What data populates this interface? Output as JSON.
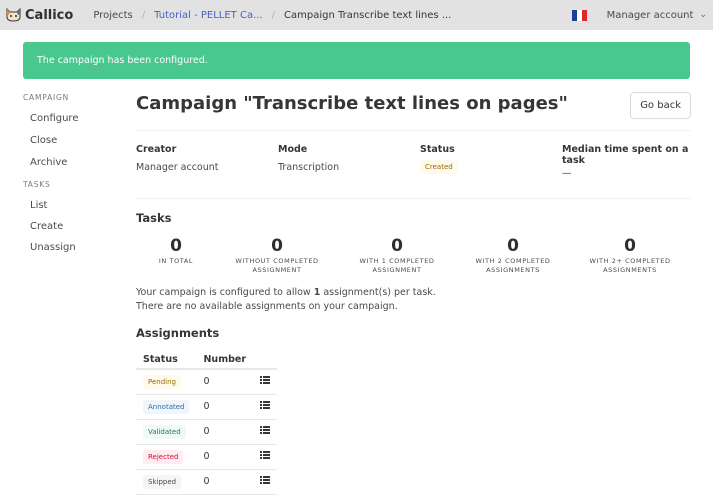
{
  "navbar": {
    "brand": "Callico",
    "projects_link": "Projects",
    "breadcrumb": [
      {
        "label": "Tutorial - PELLET Ca...",
        "link": true
      },
      {
        "label": "Campaign Transcribe text lines ...",
        "link": false
      }
    ],
    "language_flag": "flag-fr",
    "account": "Manager account"
  },
  "notification": {
    "text": "The campaign has been configured.",
    "color": "#48c78e"
  },
  "sidebar": {
    "sections": [
      {
        "label": "CAMPAIGN",
        "items": [
          "Configure",
          "Close",
          "Archive"
        ]
      },
      {
        "label": "TASKS",
        "items": [
          "List",
          "Create",
          "Unassign"
        ]
      }
    ]
  },
  "main": {
    "title": "Campaign \"Transcribe text lines on pages\"",
    "go_back": "Go back",
    "info": {
      "creator_label": "Creator",
      "creator_value": "Manager account",
      "mode_label": "Mode",
      "mode_value": "Transcription",
      "status_label": "Status",
      "status_value": "Created",
      "median_label": "Median time spent on a task",
      "median_value": "—"
    },
    "tasks": {
      "title": "Tasks",
      "stats": [
        {
          "value": "0",
          "label_line1": "IN TOTAL",
          "label_line2": ""
        },
        {
          "value": "0",
          "label_line1": "WITHOUT COMPLETED",
          "label_line2": "ASSIGNMENT"
        },
        {
          "value": "0",
          "label_line1": "WITH 1 COMPLETED",
          "label_line2": "ASSIGNMENT"
        },
        {
          "value": "0",
          "label_line1": "WITH 2 COMPLETED",
          "label_line2": "ASSIGNMENTS"
        },
        {
          "value": "0",
          "label_line1": "WITH 2+ COMPLETED",
          "label_line2": "ASSIGNMENTS"
        }
      ],
      "config_prefix": "Your campaign is configured to allow ",
      "config_count": "1",
      "config_suffix": " assignment(s) per task.",
      "availability": "There are no available assignments on your campaign."
    },
    "assignments": {
      "title": "Assignments",
      "columns": [
        "Status",
        "Number"
      ],
      "rows": [
        {
          "status": "Pending",
          "number": "0",
          "bg": "#fffaeb",
          "fg": "#946c00"
        },
        {
          "status": "Annotated",
          "number": "0",
          "bg": "#eff5fb",
          "fg": "#296fa8"
        },
        {
          "status": "Validated",
          "number": "0",
          "bg": "#effaf5",
          "fg": "#257953"
        },
        {
          "status": "Rejected",
          "number": "0",
          "bg": "#feecf0",
          "fg": "#cc0f35"
        },
        {
          "status": "Skipped",
          "number": "0",
          "bg": "#f5f5f5",
          "fg": "#4a4a4a"
        }
      ]
    }
  }
}
